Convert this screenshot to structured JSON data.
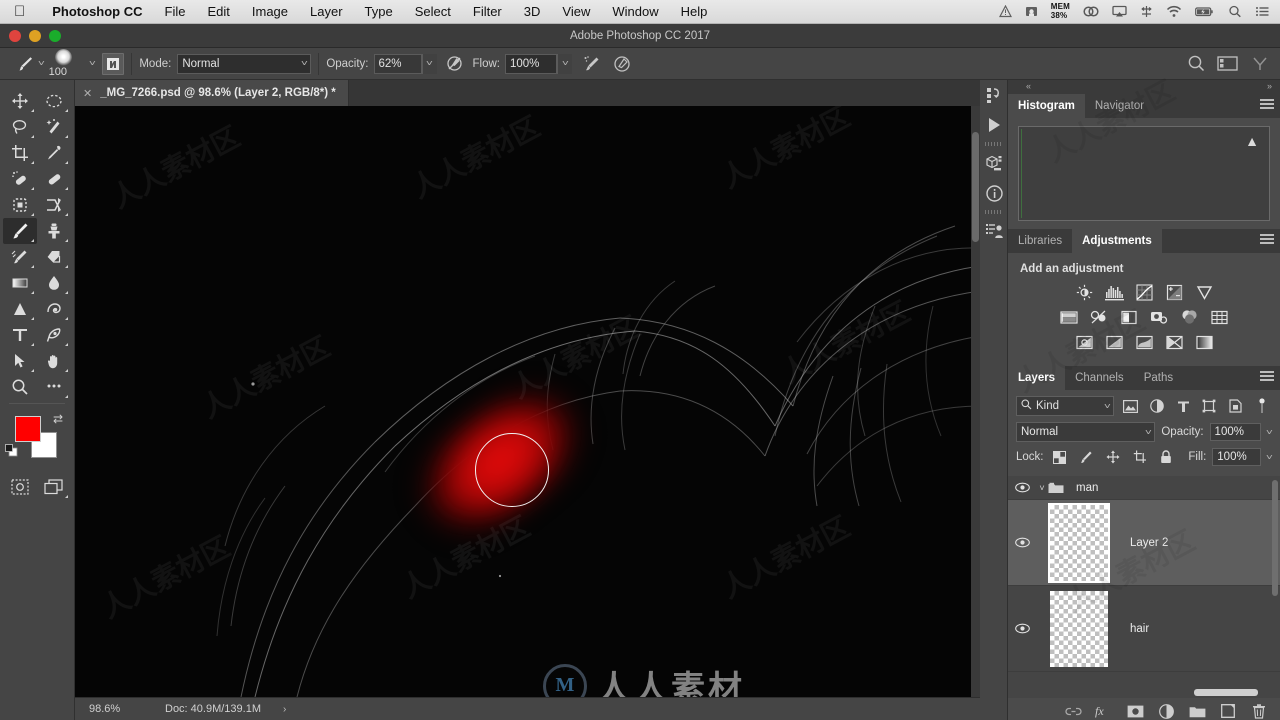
{
  "macmenu": {
    "apple_icon": "apple-icon",
    "app_name": "Photoshop CC",
    "items": [
      "File",
      "Edit",
      "Image",
      "Layer",
      "Type",
      "Select",
      "Filter",
      "3D",
      "View",
      "Window",
      "Help"
    ],
    "status_icons": [
      "warning-triangle-icon",
      "disk-icon",
      "airplay-icon",
      "dropbox-icon",
      "wifi-icon",
      "battery-charging-icon",
      "spotlight-search-icon",
      "notification-center-icon"
    ],
    "mem_label": "MEM",
    "mem_value": "38%"
  },
  "window": {
    "title": "Adobe Photoshop CC 2017",
    "close_button": "close-window-button",
    "minimize_button": "minimize-window-button",
    "zoom_button": "zoom-window-button"
  },
  "optionsbar": {
    "brush_preset_icon": "brush-preset-icon",
    "brush_size": "100",
    "brush_panel_icon": "brush-settings-panel-icon",
    "mode_label": "Mode:",
    "mode_value": "Normal",
    "opacity_label": "Opacity:",
    "opacity_value": "62%",
    "pressure_opacity_icon": "pressure-controls-opacity-icon",
    "flow_label": "Flow:",
    "flow_value": "100%",
    "airbrush_icon": "airbrush-icon",
    "pressure_size_icon": "pressure-controls-size-icon",
    "smoothing_icon": "smoothing-icon",
    "search_icon": "search-icon",
    "workspace_icon": "workspace-switcher-icon",
    "arrange_icon": "arrange-documents-icon"
  },
  "tab": {
    "close_icon": "close-tab-icon",
    "title": "_MG_7266.psd @ 98.6% (Layer 2, RGB/8*) *"
  },
  "tools": {
    "items": [
      {
        "name": "move-tool",
        "glyph": "move"
      },
      {
        "name": "elliptical-marquee-tool",
        "glyph": "marquee"
      },
      {
        "name": "lasso-tool",
        "glyph": "lasso"
      },
      {
        "name": "magic-wand-tool",
        "glyph": "wand"
      },
      {
        "name": "crop-tool",
        "glyph": "crop"
      },
      {
        "name": "eyedropper-tool",
        "glyph": "eyedropper"
      },
      {
        "name": "spot-healing-brush-tool",
        "glyph": "spot-heal"
      },
      {
        "name": "healing-brush-tool",
        "glyph": "heal"
      },
      {
        "name": "patch-tool",
        "glyph": "patch"
      },
      {
        "name": "shuffle-tool",
        "glyph": "shuffle"
      },
      {
        "name": "brush-tool",
        "glyph": "brush"
      },
      {
        "name": "clone-stamp-tool",
        "glyph": "stamp"
      },
      {
        "name": "history-brush-tool",
        "glyph": "history-brush"
      },
      {
        "name": "eraser-tool",
        "glyph": "eraser"
      },
      {
        "name": "gradient-tool",
        "glyph": "gradient"
      },
      {
        "name": "blur-tool",
        "glyph": "blur-drop"
      },
      {
        "name": "dodge-tool",
        "glyph": "dodge"
      },
      {
        "name": "pen-tool",
        "glyph": "pen-curve"
      },
      {
        "name": "horizontal-type-tool",
        "glyph": "type"
      },
      {
        "name": "freeform-pen-tool",
        "glyph": "freeform-pen"
      },
      {
        "name": "path-selection-tool",
        "glyph": "arrow"
      },
      {
        "name": "hand-tool",
        "glyph": "hand"
      },
      {
        "name": "zoom-tool",
        "glyph": "zoom"
      },
      {
        "name": "edit-toolbar-tool",
        "glyph": "ellipsis"
      }
    ],
    "active_tool": "brush-tool",
    "foreground_color": "#ff0000",
    "background_color": "#ffffff",
    "swap_colors_icon": "swap-colors-icon",
    "default_colors_icon": "default-colors-icon",
    "quick_mask_icon": "quick-mask-mode-icon",
    "screen_mode_icon": "screen-mode-icon"
  },
  "canvas": {
    "background_color": "#050505",
    "stroke_color": "#d40606",
    "brush_cursor": "brush-cursor-circle",
    "watermark_text": "人人素材",
    "watermark_mark": "M"
  },
  "statusbar": {
    "zoom": "98.6%",
    "doc": "Doc: 40.9M/139.1M",
    "expand_icon": "status-expand-icon"
  },
  "rail": {
    "icons": [
      "history-icon",
      "actions-play-icon",
      "3d-icon",
      "info-icon",
      "properties-icon"
    ]
  },
  "panels": {
    "collapse_left_icon": "collapse-panels-icon",
    "collapse_right_icon": "expand-panels-icon",
    "histogram": {
      "tabs": [
        "Histogram",
        "Navigator"
      ],
      "active_tab": "Histogram",
      "menu_icon": "panel-menu-icon",
      "warning_icon": "uncached-data-warning-icon"
    },
    "adjustments": {
      "tabs": [
        "Libraries",
        "Adjustments"
      ],
      "active_tab": "Adjustments",
      "menu_icon": "panel-menu-icon",
      "title": "Add an adjustment",
      "row1": [
        "brightness-contrast-icon",
        "levels-icon",
        "curves-icon",
        "exposure-icon",
        "vibrance-icon"
      ],
      "row2": [
        "hue-saturation-icon",
        "color-balance-icon",
        "black-white-icon",
        "photo-filter-icon",
        "channel-mixer-icon",
        "color-lookup-icon"
      ],
      "row3": [
        "invert-icon",
        "posterize-icon",
        "threshold-icon",
        "selective-color-icon",
        "gradient-map-icon"
      ]
    },
    "layers": {
      "tabs": [
        "Layers",
        "Channels",
        "Paths"
      ],
      "active_tab": "Layers",
      "menu_icon": "panel-menu-icon",
      "filter_label": "Kind",
      "filter_search_icon": "filter-search-icon",
      "filter_icons": [
        "filter-pixel-icon",
        "filter-adjustment-icon",
        "filter-type-icon",
        "filter-shape-icon",
        "filter-smart-object-icon"
      ],
      "filter_toggle_icon": "filter-toggle-icon",
      "blend_mode": "Normal",
      "opacity_label": "Opacity:",
      "opacity_value": "100%",
      "lock_label": "Lock:",
      "lock_icons": [
        "lock-transparent-pixels-icon",
        "lock-image-pixels-icon",
        "lock-position-icon",
        "lock-artboard-icon",
        "lock-all-icon"
      ],
      "fill_label": "Fill:",
      "fill_value": "100%",
      "rows": [
        {
          "name": "man",
          "type": "group",
          "visible": true,
          "expanded": true,
          "selected": false
        },
        {
          "name": "Layer 2",
          "type": "layer",
          "visible": true,
          "selected": true
        },
        {
          "name": "hair",
          "type": "layer",
          "visible": true,
          "selected": false
        }
      ],
      "footer_icons": [
        "link-layers-icon",
        "layer-style-fx-icon",
        "add-layer-mask-icon",
        "new-adjustment-layer-icon",
        "new-group-icon",
        "new-layer-icon",
        "delete-layer-icon"
      ]
    }
  }
}
